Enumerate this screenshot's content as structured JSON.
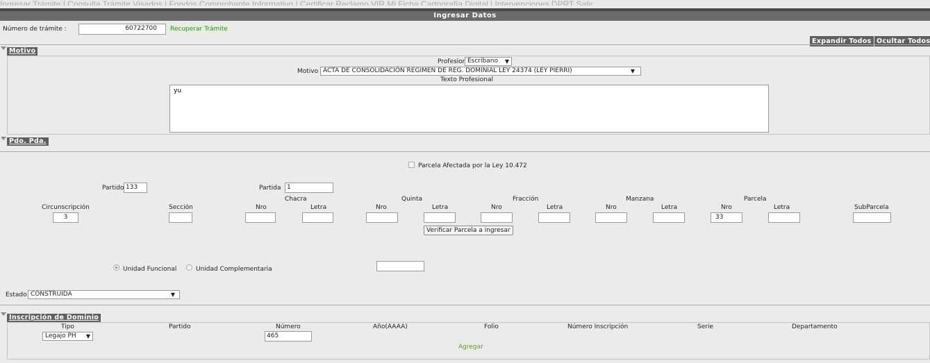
{
  "topnav": {
    "text": "Ingresar Trámite | Consulta Trámite  Visados | Fondos  Comprobante Informativo | Certificar Reclamo VIR  Mi Ficha  Cartografía Digital | Intervenciones DPRT  Salir"
  },
  "page_title": "Ingresar Datos",
  "tramite": {
    "label": "Número de trámite :",
    "value": "60722700",
    "recover_label": "Recuperar Trámite"
  },
  "actions": {
    "expand": "Expandir Todos",
    "collapse": "Ocultar Todos"
  },
  "motivo": {
    "header": "Motivo",
    "profesional_label": "Profesional",
    "profesional_value": "Escribano",
    "motivo_label": "Motivo",
    "motivo_value": "ACTA DE CONSOLIDACIÓN REGIMEN DE REG. DOMINIAL LEY 24374 (LEY PIERRI)",
    "texto_label": "Texto Profesional",
    "texto_value": "yu"
  },
  "pdo": {
    "header": "Pdo. Pda.",
    "parcela_afectada": "Parcela Afectada por la Ley 10.472",
    "partido_label": "Partido",
    "partido_value": "133",
    "partida_label": "Partida",
    "partida_value": "1",
    "groups": {
      "chacra": "Chacra",
      "quinta": "Quinta",
      "fraccion": "Fracción",
      "manzana": "Manzana",
      "parcela": "Parcela"
    },
    "cols": {
      "circ": "Circunscripción",
      "seccion": "Sección",
      "nro": "Nro",
      "letra": "Letra",
      "subparcela": "SubParcela"
    },
    "circ_value": "3",
    "parcela_nro_value": "33",
    "verificar": "Verificar Parcela a ingresar",
    "unidad_funcional": "Unidad Funcional",
    "unidad_complementaria": "Unidad Complementaria",
    "estado_label": "Estado",
    "estado_value": "CONSTRUIDA"
  },
  "inscripcion": {
    "header": "Inscripción de Dominio",
    "cols": {
      "tipo": "Tipo",
      "partido": "Partido",
      "numero": "Número",
      "anio": "Año(AAAA)",
      "folio": "Folio",
      "num_insc": "Número Inscripción",
      "serie": "Serie",
      "departamento": "Departamento"
    },
    "tipo_value": "Legajo PH",
    "numero_value": "465",
    "agregar": "Agregar"
  }
}
